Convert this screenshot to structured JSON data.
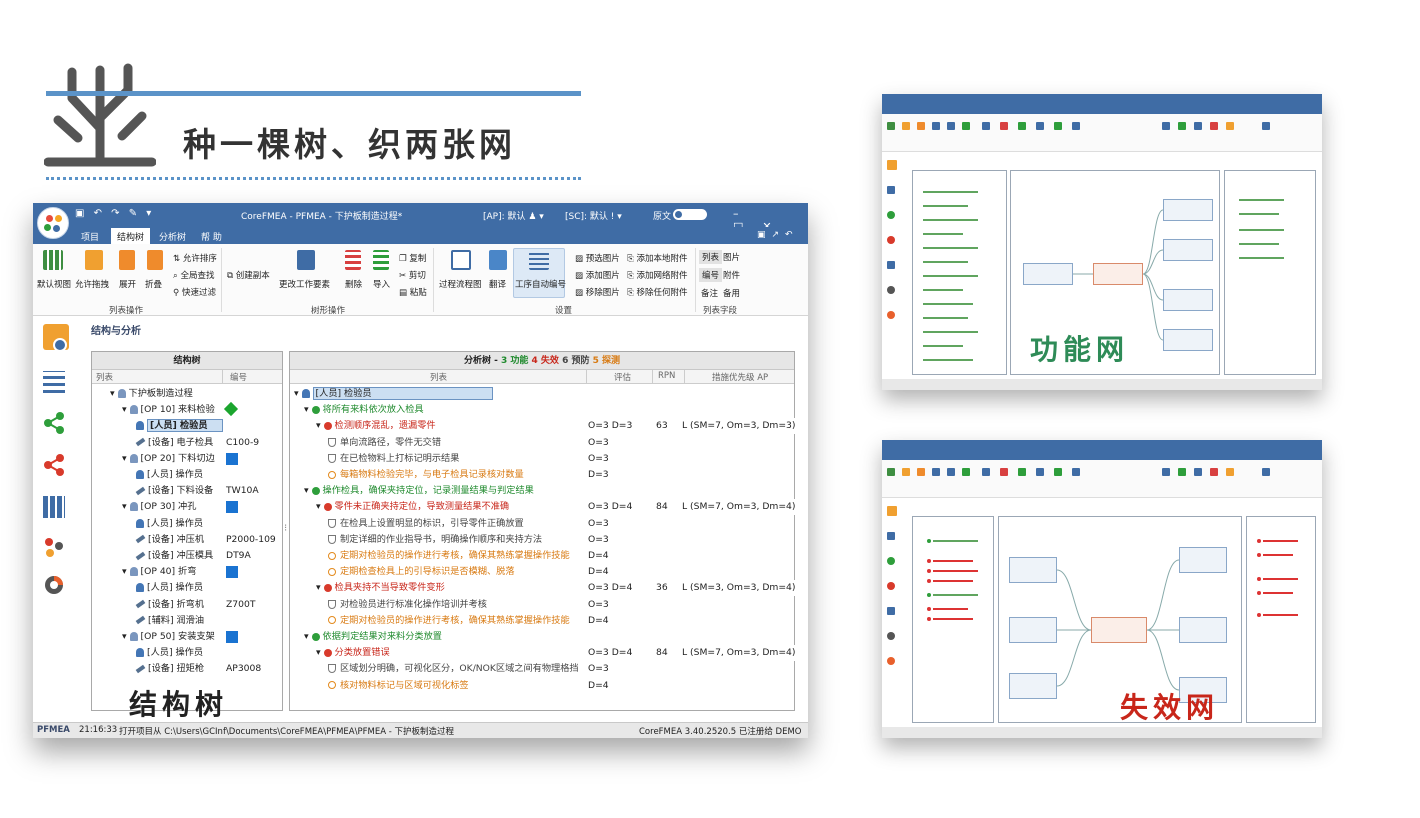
{
  "header": {
    "title": "种一棵树、织两张网"
  },
  "window": {
    "title": "CoreFMEA - PFMEA - 下护板制造过程*",
    "ap": "[AP]: 默认",
    "sc": "[SC]: 默认",
    "source": "原文",
    "tabs": [
      "项目",
      "结构树",
      "分析树",
      "帮 助"
    ],
    "ribbon": {
      "big_buttons": [
        "默认视图",
        "允许拖拽",
        "展开",
        "折叠",
        "创建副本",
        "更改工作要素",
        "删除",
        "导入",
        "过程流程图",
        "翻译",
        "工序自动编号"
      ],
      "small_left": [
        "允许排序",
        "全局查找",
        "快速过滤"
      ],
      "small_edit": [
        "复制",
        "剪切",
        "粘贴"
      ],
      "small_image": [
        "预选图片",
        "添加图片",
        "移除图片"
      ],
      "small_attach": [
        "添加本地附件",
        "添加网络附件",
        "移除任何附件"
      ],
      "list_fields": [
        "列表",
        "图片",
        "编号",
        "附件",
        "备注",
        "备用"
      ],
      "groups": [
        "列表操作",
        "树形操作",
        "设置",
        "列表字段"
      ]
    },
    "section_title": "结构与分析",
    "structure_tree": {
      "title": "结构树",
      "columns": [
        "列表",
        "编号"
      ],
      "rows": [
        {
          "label": "下护板制造过程",
          "code": ""
        },
        {
          "label": "[OP 10] 来料检验",
          "code": ""
        },
        {
          "label": "[人员] 检验员",
          "code": ""
        },
        {
          "label": "[设备] 电子检具",
          "code": "C100-9"
        },
        {
          "label": "[OP 20] 下料切边",
          "code": ""
        },
        {
          "label": "[人员] 操作员",
          "code": ""
        },
        {
          "label": "[设备] 下料设备",
          "code": "TW10A"
        },
        {
          "label": "[OP 30] 冲孔",
          "code": ""
        },
        {
          "label": "[人员] 操作员",
          "code": ""
        },
        {
          "label": "[设备] 冲压机",
          "code": "P2000-109"
        },
        {
          "label": "[设备] 冲压模具",
          "code": "DT9A"
        },
        {
          "label": "[OP 40] 折弯",
          "code": ""
        },
        {
          "label": "[人员] 操作员",
          "code": ""
        },
        {
          "label": "[设备] 折弯机",
          "code": "Z700T"
        },
        {
          "label": "[辅料] 润滑油",
          "code": ""
        },
        {
          "label": "[OP 50] 安装支架",
          "code": ""
        },
        {
          "label": "[人员] 操作员",
          "code": ""
        },
        {
          "label": "[设备] 扭矩枪",
          "code": "AP3008"
        }
      ]
    },
    "analysis_tree": {
      "title": "分析树",
      "summary": [
        "3 功能",
        "4 失效",
        "6 预防",
        "5 探测"
      ],
      "columns": [
        "列表",
        "评估",
        "RPN",
        "措施优先级 AP"
      ],
      "rows": [
        {
          "text": "[人员] 检验员",
          "eval": "",
          "rpn": "",
          "ap": ""
        },
        {
          "text": "将所有来料依次放入检具",
          "eval": "",
          "rpn": "",
          "ap": ""
        },
        {
          "text": "检测顺序混乱，遗漏零件",
          "eval": "O=3  D=3",
          "rpn": "63",
          "ap": "L  (SM=7, Om=3, Dm=3)"
        },
        {
          "text": "单向流路径，零件无交错",
          "eval": "O=3",
          "rpn": "",
          "ap": ""
        },
        {
          "text": "在已检物料上打标记明示结果",
          "eval": "O=3",
          "rpn": "",
          "ap": ""
        },
        {
          "text": "每箱物料检验完毕，与电子检具记录核对数量",
          "eval": "D=3",
          "rpn": "",
          "ap": ""
        },
        {
          "text": "操作检具，确保夹持定位，记录测量结果与判定结果",
          "eval": "",
          "rpn": "",
          "ap": ""
        },
        {
          "text": "零件未正确夹持定位，导致测量结果不准确",
          "eval": "O=3  D=4",
          "rpn": "84",
          "ap": "L  (SM=7, Om=3, Dm=4)"
        },
        {
          "text": "在检具上设置明显的标识，引导零件正确放置",
          "eval": "O=3",
          "rpn": "",
          "ap": ""
        },
        {
          "text": "制定详细的作业指导书，明确操作顺序和夹持方法",
          "eval": "O=3",
          "rpn": "",
          "ap": ""
        },
        {
          "text": "定期对检验员的操作进行考核，确保其熟练掌握操作技能",
          "eval": "D=4",
          "rpn": "",
          "ap": ""
        },
        {
          "text": "定期检查检具上的引导标识是否模糊、脱落",
          "eval": "D=4",
          "rpn": "",
          "ap": ""
        },
        {
          "text": "检具夹持不当导致零件变形",
          "eval": "O=3  D=4",
          "rpn": "36",
          "ap": "L  (SM=3, Om=3, Dm=4)"
        },
        {
          "text": "对检验员进行标准化操作培训并考核",
          "eval": "O=3",
          "rpn": "",
          "ap": ""
        },
        {
          "text": "定期对检验员的操作进行考核，确保其熟练掌握操作技能",
          "eval": "D=4",
          "rpn": "",
          "ap": ""
        },
        {
          "text": "依据判定结果对来料分类放置",
          "eval": "",
          "rpn": "",
          "ap": ""
        },
        {
          "text": "分类放置错误",
          "eval": "O=3  D=4",
          "rpn": "84",
          "ap": "L  (SM=7, Om=3, Dm=4)"
        },
        {
          "text": "区域划分明确，可视化区分，OK/NOK区域之间有物理格挡",
          "eval": "O=3",
          "rpn": "",
          "ap": ""
        },
        {
          "text": "核对物料标记与区域可视化标签",
          "eval": "D=4",
          "rpn": "",
          "ap": ""
        }
      ]
    },
    "overlay_label": "结构树",
    "status": {
      "mode": "PFMEA",
      "time": "21:16:33",
      "path": "打开项目从 C:\\Users\\GCInf\\Documents\\CoreFMEA\\PFMEA\\PFMEA - 下护板制造过程",
      "version": "CoreFMEA 3.40.2520.5  已注册给 DEMO"
    }
  },
  "function_net": {
    "label": "功能网"
  },
  "failure_net": {
    "label": "失效网"
  },
  "colors": {
    "brand": "#3f6ca5",
    "accent_line": "#5b93c8",
    "function": "#1f8a2d",
    "failure": "#c8261a",
    "prevention": "#444444",
    "detection": "#d87a12"
  }
}
